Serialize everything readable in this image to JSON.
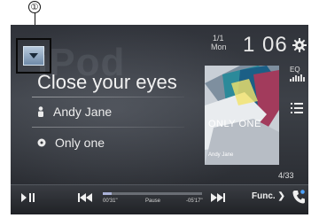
{
  "callout": "①",
  "watermark": "iPod",
  "date": {
    "top": "1/1",
    "day": "Mon"
  },
  "clock": "1 06",
  "eq_label": "EQ",
  "track": {
    "title": "Close your eyes",
    "artist": "Andy Jane",
    "album": "Only one"
  },
  "album_art": {
    "title": "ONLY ONE",
    "artist": "Andy Jane"
  },
  "track_count": "4/33",
  "playback": {
    "elapsed": "00'31\"",
    "status": "Pause",
    "remaining": "-05'17\"",
    "progress": 0.09
  },
  "func_label": "Func.",
  "colors": {
    "phone_icon": "#4da3ff",
    "progress": "#aab2d8"
  }
}
